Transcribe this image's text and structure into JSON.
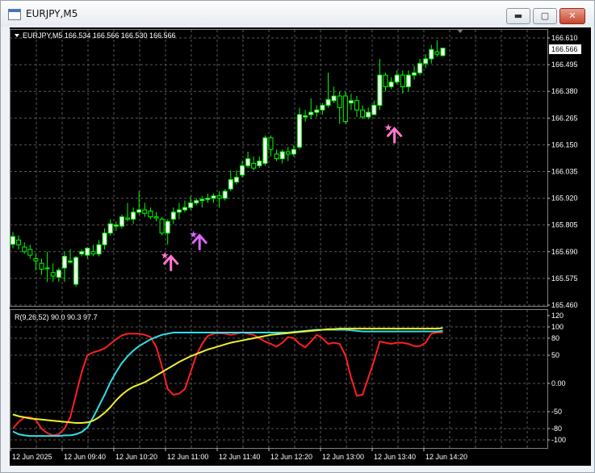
{
  "window": {
    "title": "EURJPY,M5",
    "buttons": {
      "minimize": "▬",
      "maximize": "▢",
      "close": "✕"
    }
  },
  "price_panel": {
    "header": "EURJPY,M5  166.534 166.566 166.530 166.566",
    "current_price": "166.566",
    "y_labels": [
      "166.610",
      "166.495",
      "166.380",
      "166.265",
      "166.150",
      "166.035",
      "165.920",
      "165.805",
      "165.690",
      "165.575",
      "165.460"
    ]
  },
  "indicator_panel": {
    "header": "R(9,26,52) 90.0 90.3 97.7",
    "y_labels": [
      "120",
      "100",
      "80",
      "50",
      "0.00",
      "-50",
      "-80",
      "-100"
    ]
  },
  "time_axis": {
    "labels": [
      "12 Jun 2025",
      "12 Jun 09:40",
      "12 Jun 10:20",
      "12 Jun 11:00",
      "12 Jun 11:40",
      "12 Jun 12:20",
      "12 Jun 13:00",
      "12 Jun 13:40",
      "12 Jun 14:20"
    ]
  },
  "chart_data": {
    "type": "line",
    "title": "",
    "price_axis_range": [
      165.46,
      166.61
    ],
    "candles": [
      {
        "o": 165.722,
        "c": 165.755,
        "h": 165.775,
        "l": 165.705
      },
      {
        "o": 165.74,
        "c": 165.72,
        "h": 165.76,
        "l": 165.7
      },
      {
        "o": 165.71,
        "c": 165.69,
        "h": 165.73,
        "l": 165.68
      },
      {
        "o": 165.7,
        "c": 165.675,
        "h": 165.72,
        "l": 165.66
      },
      {
        "o": 165.66,
        "c": 165.65,
        "h": 165.68,
        "l": 165.61
      },
      {
        "o": 165.64,
        "c": 165.615,
        "h": 165.66,
        "l": 165.59
      },
      {
        "o": 165.62,
        "c": 165.62,
        "h": 165.69,
        "l": 165.56
      },
      {
        "o": 165.6,
        "c": 165.585,
        "h": 165.64,
        "l": 165.56
      },
      {
        "o": 165.58,
        "c": 165.61,
        "h": 165.62,
        "l": 165.56
      },
      {
        "o": 165.62,
        "c": 165.67,
        "h": 165.69,
        "l": 165.56
      },
      {
        "o": 165.645,
        "c": 165.65,
        "h": 165.7,
        "l": 165.64
      },
      {
        "o": 165.55,
        "c": 165.665,
        "h": 165.67,
        "l": 165.54
      },
      {
        "o": 165.68,
        "c": 165.69,
        "h": 165.7,
        "l": 165.67
      },
      {
        "o": 165.675,
        "c": 165.705,
        "h": 165.71,
        "l": 165.66
      },
      {
        "o": 165.69,
        "c": 165.68,
        "h": 165.72,
        "l": 165.67
      },
      {
        "o": 165.68,
        "c": 165.72,
        "h": 165.74,
        "l": 165.67
      },
      {
        "o": 165.72,
        "c": 165.77,
        "h": 165.79,
        "l": 165.7
      },
      {
        "o": 165.77,
        "c": 165.81,
        "h": 165.83,
        "l": 165.76
      },
      {
        "o": 165.8,
        "c": 165.805,
        "h": 165.82,
        "l": 165.78
      },
      {
        "o": 165.8,
        "c": 165.84,
        "h": 165.85,
        "l": 165.79
      },
      {
        "o": 165.835,
        "c": 165.83,
        "h": 165.9,
        "l": 165.82
      },
      {
        "o": 165.83,
        "c": 165.86,
        "h": 165.88,
        "l": 165.81
      },
      {
        "o": 165.86,
        "c": 165.87,
        "h": 165.95,
        "l": 165.85
      },
      {
        "o": 165.87,
        "c": 165.855,
        "h": 165.9,
        "l": 165.84
      },
      {
        "o": 165.865,
        "c": 165.84,
        "h": 165.88,
        "l": 165.83
      },
      {
        "o": 165.84,
        "c": 165.835,
        "h": 165.86,
        "l": 165.82
      },
      {
        "o": 165.83,
        "c": 165.77,
        "h": 165.84,
        "l": 165.76
      },
      {
        "o": 165.77,
        "c": 165.82,
        "h": 165.83,
        "l": 165.72
      },
      {
        "o": 165.83,
        "c": 165.86,
        "h": 165.88,
        "l": 165.81
      },
      {
        "o": 165.86,
        "c": 165.87,
        "h": 165.9,
        "l": 165.83
      },
      {
        "o": 165.87,
        "c": 165.88,
        "h": 165.91,
        "l": 165.86
      },
      {
        "o": 165.88,
        "c": 165.9,
        "h": 165.93,
        "l": 165.87
      },
      {
        "o": 165.9,
        "c": 165.91,
        "h": 165.92,
        "l": 165.89
      },
      {
        "o": 165.91,
        "c": 165.915,
        "h": 165.93,
        "l": 165.88
      },
      {
        "o": 165.915,
        "c": 165.92,
        "h": 165.94,
        "l": 165.9
      },
      {
        "o": 165.92,
        "c": 165.93,
        "h": 165.94,
        "l": 165.9
      },
      {
        "o": 165.93,
        "c": 165.92,
        "h": 165.95,
        "l": 165.88
      },
      {
        "o": 165.92,
        "c": 165.95,
        "h": 165.96,
        "l": 165.91
      },
      {
        "o": 165.96,
        "c": 166.0,
        "h": 166.04,
        "l": 165.95
      },
      {
        "o": 165.99,
        "c": 166.01,
        "h": 166.04,
        "l": 165.98
      },
      {
        "o": 166.02,
        "c": 166.06,
        "h": 166.08,
        "l": 166.01
      },
      {
        "o": 166.06,
        "c": 166.09,
        "h": 166.12,
        "l": 166.05
      },
      {
        "o": 166.07,
        "c": 166.05,
        "h": 166.1,
        "l": 166.04
      },
      {
        "o": 166.06,
        "c": 166.08,
        "h": 166.1,
        "l": 166.05
      },
      {
        "o": 166.07,
        "c": 166.18,
        "h": 166.19,
        "l": 166.06
      },
      {
        "o": 166.18,
        "c": 166.13,
        "h": 166.19,
        "l": 166.1
      },
      {
        "o": 166.11,
        "c": 166.09,
        "h": 166.13,
        "l": 166.08
      },
      {
        "o": 166.09,
        "c": 166.12,
        "h": 166.13,
        "l": 166.07
      },
      {
        "o": 166.12,
        "c": 166.11,
        "h": 166.14,
        "l": 166.08
      },
      {
        "o": 166.11,
        "c": 166.13,
        "h": 166.15,
        "l": 166.1
      },
      {
        "o": 166.14,
        "c": 166.28,
        "h": 166.31,
        "l": 166.13
      },
      {
        "o": 166.27,
        "c": 166.275,
        "h": 166.3,
        "l": 166.25
      },
      {
        "o": 166.28,
        "c": 166.29,
        "h": 166.35,
        "l": 166.26
      },
      {
        "o": 166.29,
        "c": 166.3,
        "h": 166.32,
        "l": 166.27
      },
      {
        "o": 166.3,
        "c": 166.32,
        "h": 166.33,
        "l": 166.28
      },
      {
        "o": 166.32,
        "c": 166.345,
        "h": 166.46,
        "l": 166.31
      },
      {
        "o": 166.34,
        "c": 166.36,
        "h": 166.4,
        "l": 166.33
      },
      {
        "o": 166.36,
        "c": 166.31,
        "h": 166.38,
        "l": 166.24
      },
      {
        "o": 166.36,
        "c": 166.25,
        "h": 166.38,
        "l": 166.24
      },
      {
        "o": 166.33,
        "c": 166.34,
        "h": 166.37,
        "l": 166.3
      },
      {
        "o": 166.34,
        "c": 166.3,
        "h": 166.36,
        "l": 166.27
      },
      {
        "o": 166.3,
        "c": 166.27,
        "h": 166.32,
        "l": 166.26
      },
      {
        "o": 166.27,
        "c": 166.29,
        "h": 166.31,
        "l": 166.26
      },
      {
        "o": 166.28,
        "c": 166.32,
        "h": 166.34,
        "l": 166.28
      },
      {
        "o": 166.32,
        "c": 166.45,
        "h": 166.52,
        "l": 166.3
      },
      {
        "o": 166.45,
        "c": 166.4,
        "h": 166.46,
        "l": 166.38
      },
      {
        "o": 166.4,
        "c": 166.42,
        "h": 166.44,
        "l": 166.39
      },
      {
        "o": 166.42,
        "c": 166.45,
        "h": 166.47,
        "l": 166.41
      },
      {
        "o": 166.45,
        "c": 166.4,
        "h": 166.47,
        "l": 166.37
      },
      {
        "o": 166.4,
        "c": 166.45,
        "h": 166.47,
        "l": 166.38
      },
      {
        "o": 166.45,
        "c": 166.46,
        "h": 166.49,
        "l": 166.43
      },
      {
        "o": 166.46,
        "c": 166.5,
        "h": 166.52,
        "l": 166.45
      },
      {
        "o": 166.5,
        "c": 166.52,
        "h": 166.54,
        "l": 166.48
      },
      {
        "o": 166.52,
        "c": 166.56,
        "h": 166.58,
        "l": 166.5
      },
      {
        "o": 166.55,
        "c": 166.54,
        "h": 166.6,
        "l": 166.53
      },
      {
        "o": 166.534,
        "c": 166.566,
        "h": 166.566,
        "l": 166.53
      }
    ],
    "signals": [
      {
        "bar": 27,
        "price": 165.75,
        "color": "#ff77cc"
      },
      {
        "bar": 32,
        "price": 165.84,
        "color": "#dd66ff"
      },
      {
        "bar": 66,
        "price": 166.3,
        "color": "#ff77cc"
      }
    ],
    "indicator_range": [
      -110,
      120
    ],
    "indicator_series": [
      {
        "color": "#ff2020",
        "values": [
          -80,
          -68,
          -60,
          -60,
          -65,
          -80,
          -88,
          -92,
          -90,
          -80,
          -60,
          -20,
          20,
          50,
          55,
          58,
          62,
          70,
          78,
          85,
          88,
          88,
          88,
          86,
          82,
          65,
          30,
          -10,
          -20,
          -18,
          -10,
          20,
          50,
          70,
          84,
          88,
          89,
          88,
          86,
          88,
          90,
          88,
          86,
          80,
          74,
          70,
          65,
          72,
          82,
          80,
          70,
          64,
          74,
          86,
          80,
          70,
          72,
          70,
          50,
          10,
          -22,
          -20,
          10,
          40,
          74,
          72,
          70,
          72,
          72,
          70,
          66,
          66,
          72,
          88,
          90,
          90
        ]
      },
      {
        "color": "#30e0e8",
        "values": [
          -85,
          -90,
          -92,
          -93,
          -93,
          -93,
          -93,
          -93,
          -93,
          -92,
          -92,
          -90,
          -86,
          -78,
          -60,
          -40,
          -20,
          2,
          20,
          36,
          48,
          58,
          66,
          72,
          78,
          82,
          86,
          88,
          90,
          90,
          90,
          90,
          90,
          90,
          90,
          90,
          90,
          90,
          90,
          90,
          90,
          90,
          90,
          90,
          90,
          90,
          90,
          90,
          90,
          91,
          92,
          93,
          94,
          95,
          95,
          95,
          95,
          95,
          95,
          94,
          93,
          92,
          92,
          92,
          92,
          92,
          92,
          92,
          92,
          92,
          92,
          92,
          92,
          92,
          92,
          93
        ]
      },
      {
        "color": "#f0f030",
        "values": [
          -55,
          -58,
          -60,
          -62,
          -63,
          -64,
          -65,
          -66,
          -67,
          -68,
          -69,
          -70,
          -70,
          -69,
          -66,
          -60,
          -52,
          -42,
          -30,
          -20,
          -12,
          -6,
          -2,
          2,
          8,
          14,
          20,
          26,
          32,
          38,
          43,
          48,
          52,
          56,
          60,
          63,
          66,
          69,
          72,
          74,
          76,
          78,
          80,
          82,
          84,
          86,
          87,
          88,
          89,
          90,
          91,
          92,
          93,
          94,
          95,
          96,
          96,
          97,
          97,
          97,
          97,
          97,
          97,
          97,
          97,
          97,
          97,
          97,
          97,
          97,
          97,
          97,
          97,
          97,
          97,
          98
        ]
      }
    ]
  }
}
